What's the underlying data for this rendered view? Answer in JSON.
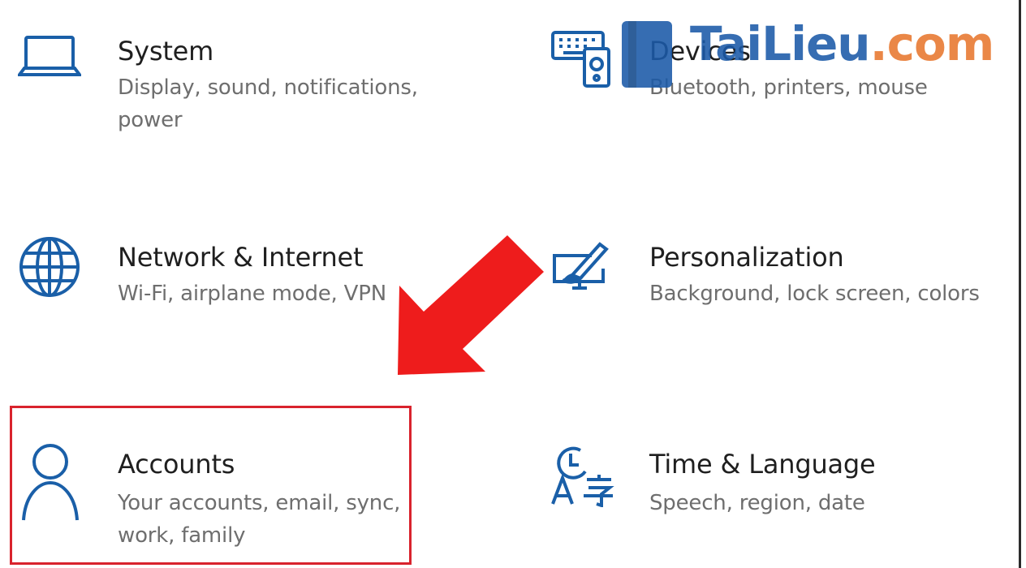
{
  "accent_color": "#1a5fa8",
  "highlight_color": "#d9232d",
  "tiles": [
    {
      "id": "system",
      "title": "System",
      "description": "Display, sound, notifications, power",
      "icon": "laptop-icon"
    },
    {
      "id": "devices",
      "title": "Devices",
      "description": "Bluetooth, printers, mouse",
      "icon": "keyboard-speaker-icon"
    },
    {
      "id": "network",
      "title": "Network & Internet",
      "description": "Wi-Fi, airplane mode, VPN",
      "icon": "globe-icon"
    },
    {
      "id": "personalization",
      "title": "Personalization",
      "description": "Background, lock screen, colors",
      "icon": "paint-monitor-icon"
    },
    {
      "id": "accounts",
      "title": "Accounts",
      "description": "Your accounts, email, sync, work, family",
      "icon": "person-icon"
    },
    {
      "id": "time",
      "title": "Time & Language",
      "description": "Speech, region, date",
      "icon": "clock-language-icon"
    }
  ],
  "watermark": {
    "part1": "TaiLieu",
    "part2": ".com"
  }
}
